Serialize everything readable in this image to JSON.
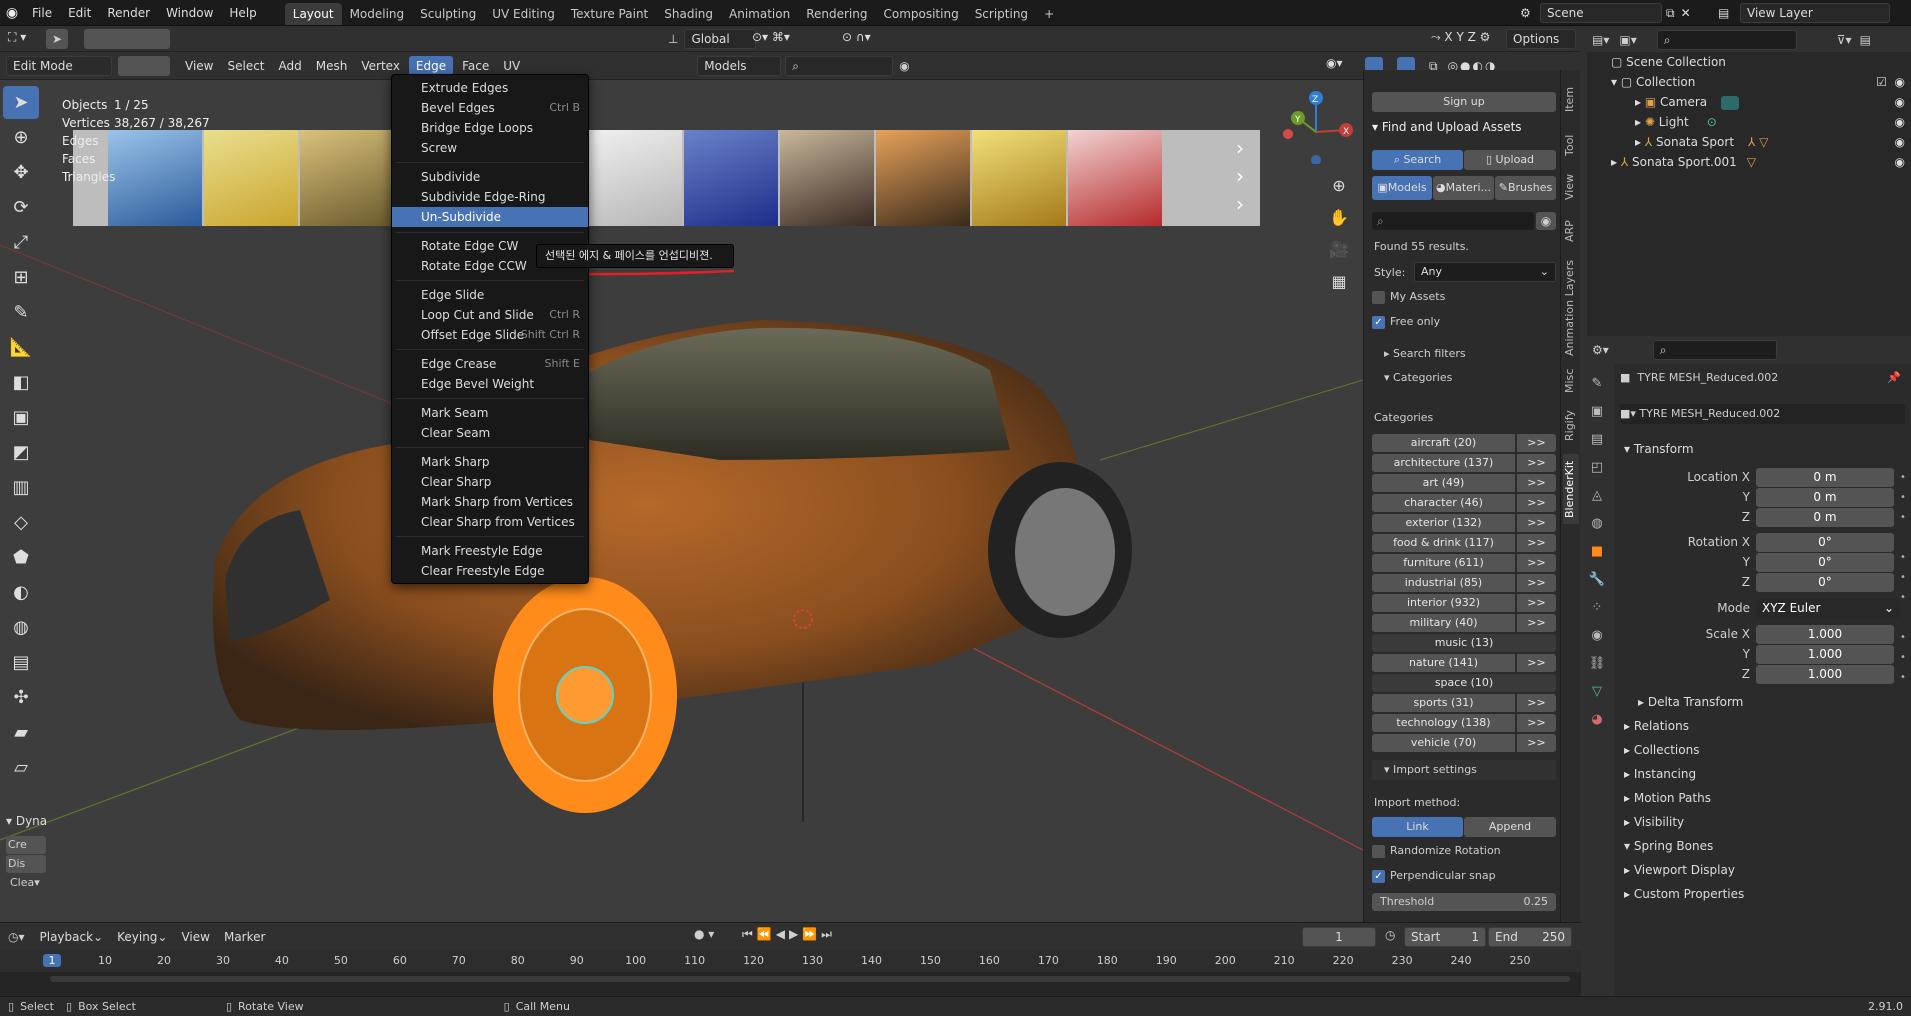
{
  "app": {
    "menus": [
      "File",
      "Edit",
      "Render",
      "Window",
      "Help"
    ],
    "workspaces": [
      "Layout",
      "Modeling",
      "Sculpting",
      "UV Editing",
      "Texture Paint",
      "Shading",
      "Animation",
      "Rendering",
      "Compositing",
      "Scripting"
    ],
    "active_workspace": "Layout",
    "scene": "Scene",
    "view_layer": "View Layer",
    "version": "2.91.0"
  },
  "viewport_header": {
    "mode": "Edit Mode",
    "menus": [
      "View",
      "Select",
      "Add",
      "Mesh",
      "Vertex",
      "Edge",
      "Face",
      "UV"
    ],
    "active_menu": "Edge",
    "transform_orientation": "Global",
    "options": "Options",
    "models_dropdown": "Models"
  },
  "stats": {
    "objects_label": "Objects",
    "objects": "1 / 25",
    "vertices_label": "Vertices",
    "vertices": "38,267 / 38,267",
    "edges_label": "Edges",
    "faces_label": "Faces",
    "triangles_label": "Triangles"
  },
  "edge_menu": {
    "items": [
      {
        "label": "Extrude Edges",
        "shortcut": ""
      },
      {
        "label": "Bevel Edges",
        "shortcut": "Ctrl B"
      },
      {
        "label": "Bridge Edge Loops",
        "shortcut": ""
      },
      {
        "label": "Screw",
        "shortcut": ""
      },
      {
        "label": "Subdivide",
        "shortcut": ""
      },
      {
        "label": "Subdivide Edge-Ring",
        "shortcut": ""
      },
      {
        "label": "Un-Subdivide",
        "shortcut": ""
      },
      {
        "label": "Rotate Edge CW",
        "shortcut": ""
      },
      {
        "label": "Rotate Edge CCW",
        "shortcut": ""
      },
      {
        "label": "Edge Slide",
        "shortcut": ""
      },
      {
        "label": "Loop Cut and Slide",
        "shortcut": "Ctrl R"
      },
      {
        "label": "Offset Edge Slide",
        "shortcut": "Shift Ctrl R"
      },
      {
        "label": "Edge Crease",
        "shortcut": "Shift E"
      },
      {
        "label": "Edge Bevel Weight",
        "shortcut": ""
      },
      {
        "label": "Mark Seam",
        "shortcut": ""
      },
      {
        "label": "Clear Seam",
        "shortcut": ""
      },
      {
        "label": "Mark Sharp",
        "shortcut": ""
      },
      {
        "label": "Clear Sharp",
        "shortcut": ""
      },
      {
        "label": "Mark Sharp from Vertices",
        "shortcut": ""
      },
      {
        "label": "Clear Sharp from Vertices",
        "shortcut": ""
      },
      {
        "label": "Mark Freestyle Edge",
        "shortcut": ""
      },
      {
        "label": "Clear Freestyle Edge",
        "shortcut": ""
      }
    ],
    "highlighted": "Un-Subdivide",
    "tooltip": "선택된 에지 & 페이스를 언섭디비젼."
  },
  "toolbar_panel": {
    "label": "Dyna",
    "items": [
      "Cre",
      "Dis",
      "Clea"
    ]
  },
  "sidebar": {
    "sign_up": "Sign up",
    "section_title": "Find and Upload Assets",
    "search_tab": "Search",
    "upload_tab": "Upload",
    "asset_tabs": [
      "Models",
      "Materi...",
      "Brushes"
    ],
    "found": "Found 55 results.",
    "style_label": "Style:",
    "style_value": "Any",
    "my_assets": "My Assets",
    "free_only": "Free only",
    "search_filters": "Search filters",
    "categories_toggle": "Categories",
    "categories_label": "Categories",
    "categories": [
      {
        "name": "aircraft (20)",
        "more": ">>"
      },
      {
        "name": "architecture (137)",
        "more": ">>"
      },
      {
        "name": "art (49)",
        "more": ">>"
      },
      {
        "name": "character (46)",
        "more": ">>"
      },
      {
        "name": "exterior (132)",
        "more": ">>"
      },
      {
        "name": "food & drink (117)",
        "more": ">>"
      },
      {
        "name": "furniture (611)",
        "more": ">>"
      },
      {
        "name": "industrial (85)",
        "more": ">>"
      },
      {
        "name": "interior (932)",
        "more": ">>"
      },
      {
        "name": "military (40)",
        "more": ">>"
      },
      {
        "name": "music (13)",
        "more": ""
      },
      {
        "name": "nature (141)",
        "more": ">>"
      },
      {
        "name": "space (10)",
        "more": ""
      },
      {
        "name": "sports (31)",
        "more": ">>"
      },
      {
        "name": "technology (138)",
        "more": ">>"
      },
      {
        "name": "vehicle (70)",
        "more": ">>"
      }
    ],
    "import_settings": "Import settings",
    "import_method": "Import method:",
    "link": "Link",
    "append": "Append",
    "randomize_rotation": "Randomize Rotation",
    "perpendicular_snap": "Perpendicular snap",
    "threshold_label": "Threshold",
    "threshold_value": "0.25",
    "vtabs": [
      "Item",
      "Tool",
      "View",
      "ARP",
      "Animation Layers",
      "Misc",
      "Rigify",
      "BlenderKit"
    ]
  },
  "outliner": {
    "root": "Scene Collection",
    "items": [
      {
        "label": "Collection",
        "depth": 1
      },
      {
        "label": "Camera",
        "depth": 2
      },
      {
        "label": "Light",
        "depth": 2
      },
      {
        "label": "Sonata Sport",
        "depth": 2
      },
      {
        "label": "Sonata Sport.001",
        "depth": 1
      }
    ]
  },
  "properties": {
    "object_name": "TYRE MESH_Reduced.002",
    "mesh_name": "TYRE MESH_Reduced.002",
    "transform": "Transform",
    "location_label": "Location X",
    "location": [
      "0 m",
      "0 m",
      "0 m"
    ],
    "rotation_label": "Rotation X",
    "rotation": [
      "0°",
      "0°",
      "0°"
    ],
    "mode_label": "Mode",
    "mode": "XYZ Euler",
    "scale_label": "Scale X",
    "scale": [
      "1.000",
      "1.000",
      "1.000"
    ],
    "y": "Y",
    "z": "Z",
    "delta": "Delta Transform",
    "sections": [
      "Relations",
      "Collections",
      "Instancing",
      "Motion Paths",
      "Visibility",
      "Spring Bones",
      "Viewport Display",
      "Custom Properties"
    ]
  },
  "timeline": {
    "menus": [
      "Playback",
      "Keying",
      "View",
      "Marker"
    ],
    "current_frame": "1",
    "start_label": "Start",
    "start": "1",
    "end_label": "End",
    "end": "250",
    "ticks": [
      "1",
      "10",
      "20",
      "30",
      "40",
      "50",
      "60",
      "70",
      "80",
      "90",
      "100",
      "110",
      "120",
      "130",
      "140",
      "150",
      "160",
      "170",
      "180",
      "190",
      "200",
      "210",
      "220",
      "230",
      "240",
      "250"
    ]
  },
  "statusbar": {
    "select": "Select",
    "box_select": "Box Select",
    "rotate_view": "Rotate View",
    "call_menu": "Call Menu"
  },
  "colors": {
    "accent": "#4772b3",
    "annotation": "#e0202a",
    "selection": "#ff8c1a"
  }
}
